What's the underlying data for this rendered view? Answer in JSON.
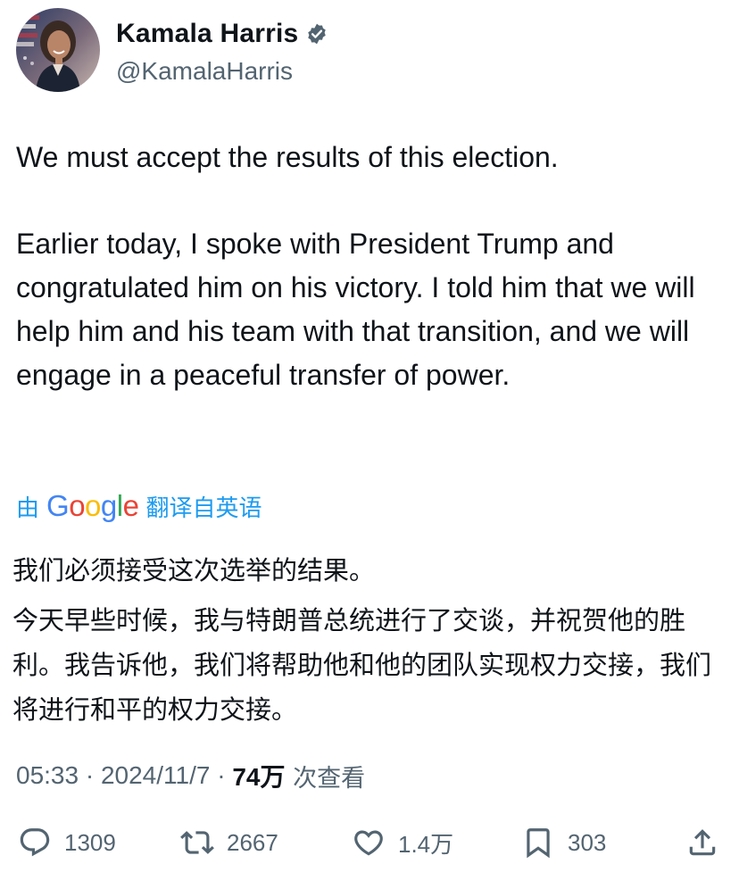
{
  "user": {
    "display_name": "Kamala Harris",
    "handle": "@KamalaHarris",
    "verified": true,
    "verified_color": "#536471"
  },
  "tweet": {
    "paragraphs": [
      "We must accept the results of this election.",
      "Earlier today, I spoke with President Trump and congratulated him on his victory. I told him that we will help him and his team with that transition, and we will engage in a peaceful transfer of power."
    ]
  },
  "translation": {
    "prefix": "由",
    "provider": "Google",
    "suffix": "翻译自英语",
    "link_color": "#1d9bf0",
    "paragraphs": [
      "我们必须接受这次选举的结果。",
      "今天早些时候，我与特朗普总统进行了交谈，并祝贺他的胜利。我告诉他，我们将帮助他和他的团队实现权力交接，我们将进行和平的权力交接。"
    ]
  },
  "meta": {
    "time": "05:33",
    "separator": " · ",
    "date": "2024/11/7",
    "views_count": "74万",
    "views_label": " 次查看"
  },
  "actions": {
    "reply": {
      "icon": "reply-icon",
      "count": "1309"
    },
    "retweet": {
      "icon": "retweet-icon",
      "count": "2667"
    },
    "like": {
      "icon": "heart-icon",
      "count": "1.4万"
    },
    "bookmark": {
      "icon": "bookmark-icon",
      "count": "303"
    },
    "share": {
      "icon": "share-icon"
    }
  }
}
